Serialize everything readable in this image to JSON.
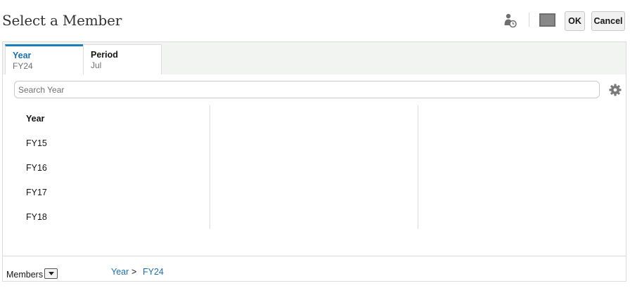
{
  "dialog": {
    "title": "Select a Member"
  },
  "toolbar": {
    "ok_label": "OK",
    "cancel_label": "Cancel"
  },
  "tabs": [
    {
      "name": "Year",
      "value": "FY24",
      "selected": true
    },
    {
      "name": "Period",
      "value": "Jul",
      "selected": false
    }
  ],
  "search": {
    "placeholder": "Search Year"
  },
  "members": {
    "header": "Year",
    "items": [
      "FY15",
      "FY16",
      "FY17",
      "FY18"
    ]
  },
  "footer": {
    "members_label": "Members",
    "breadcrumb": [
      {
        "label": "Year"
      },
      {
        "separator": ">"
      },
      {
        "label": "FY24"
      }
    ]
  },
  "colors": {
    "accent": "#1e7db8",
    "link": "#1e6ea6",
    "border": "#dcdcdc",
    "tabbar_bg": "#f2f4f2"
  },
  "icons": [
    "person-clock-icon",
    "square-icon",
    "gear-icon",
    "chevron-down-icon"
  ]
}
